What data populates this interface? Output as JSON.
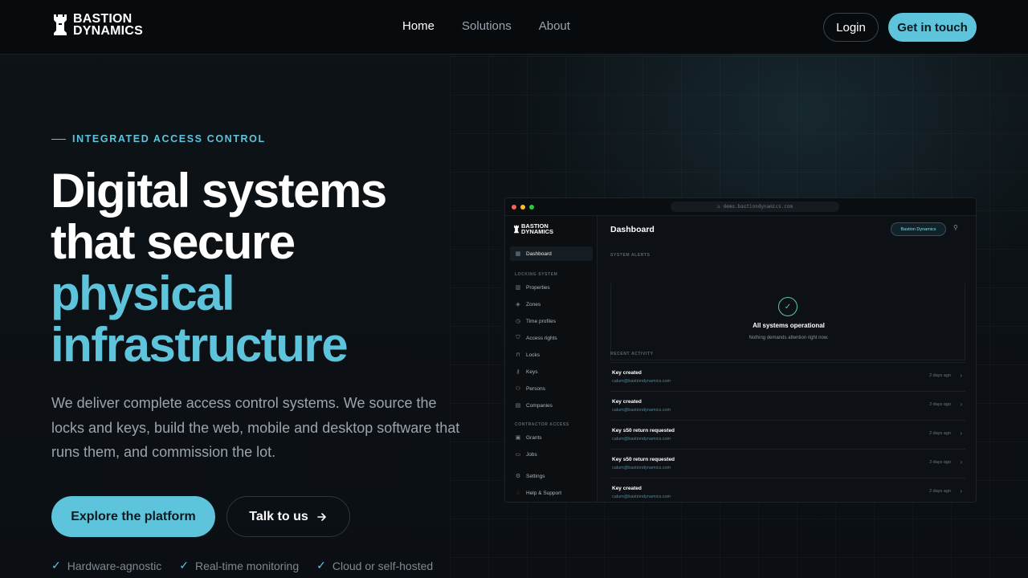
{
  "brand": {
    "line1": "BASTION",
    "line2": "DYNAMICS"
  },
  "nav": {
    "links": [
      {
        "label": "Home",
        "active": true
      },
      {
        "label": "Solutions",
        "active": false
      },
      {
        "label": "About",
        "active": false
      }
    ],
    "login_label": "Login",
    "cta_label": "Get in touch"
  },
  "hero": {
    "eyebrow": "INTEGRATED ACCESS CONTROL",
    "headline_white_1": "Digital systems",
    "headline_white_2": "that secure",
    "headline_accent_1": "physical",
    "headline_accent_2": "infrastructure",
    "subcopy": "We deliver complete access control systems. We source the locks and keys, build the web, mobile and desktop software that runs them, and commission the lot.",
    "primary_button": "Explore the platform",
    "secondary_button": "Talk to us",
    "features": [
      "Hardware-agnostic",
      "Real-time monitoring",
      "Cloud or self-hosted"
    ]
  },
  "mock": {
    "url": "demo.bastiondynamics.com",
    "logo_line1": "BASTION",
    "logo_line2": "DYNAMICS",
    "sidebar": {
      "dashboard": "Dashboard",
      "locking_heading": "LOCKING SYSTEM",
      "locking_items": [
        "Properties",
        "Zones",
        "Time profiles",
        "Access rights",
        "Locks",
        "Keys",
        "Persons",
        "Companies"
      ],
      "contractor_heading": "CONTRACTOR ACCESS",
      "contractor_items": [
        "Grants",
        "Jobs"
      ],
      "bottom_items": [
        "Settings",
        "Help & Support"
      ]
    },
    "title": "Dashboard",
    "org_pill": "Bastion Dynamics",
    "alerts_heading": "SYSTEM ALERTS",
    "alert_title": "All systems operational",
    "alert_sub": "Nothing demands attention right now.",
    "activity_heading": "RECENT ACTIVITY",
    "activity": [
      {
        "title": "Key created",
        "email": "calum@bastiondynamics.com",
        "time": "2 days ago"
      },
      {
        "title": "Key created",
        "email": "calum@bastiondynamics.com",
        "time": "2 days ago"
      },
      {
        "title": "Key s50 return requested",
        "email": "calum@bastiondynamics.com",
        "time": "2 days ago"
      },
      {
        "title": "Key s50 return requested",
        "email": "calum@bastiondynamics.com",
        "time": "2 days ago"
      },
      {
        "title": "Key created",
        "email": "calum@bastiondynamics.com",
        "time": "2 days ago"
      }
    ]
  },
  "colors": {
    "accent": "#5ec4dc",
    "background": "#0b0f13",
    "success": "#5fc9a6"
  }
}
